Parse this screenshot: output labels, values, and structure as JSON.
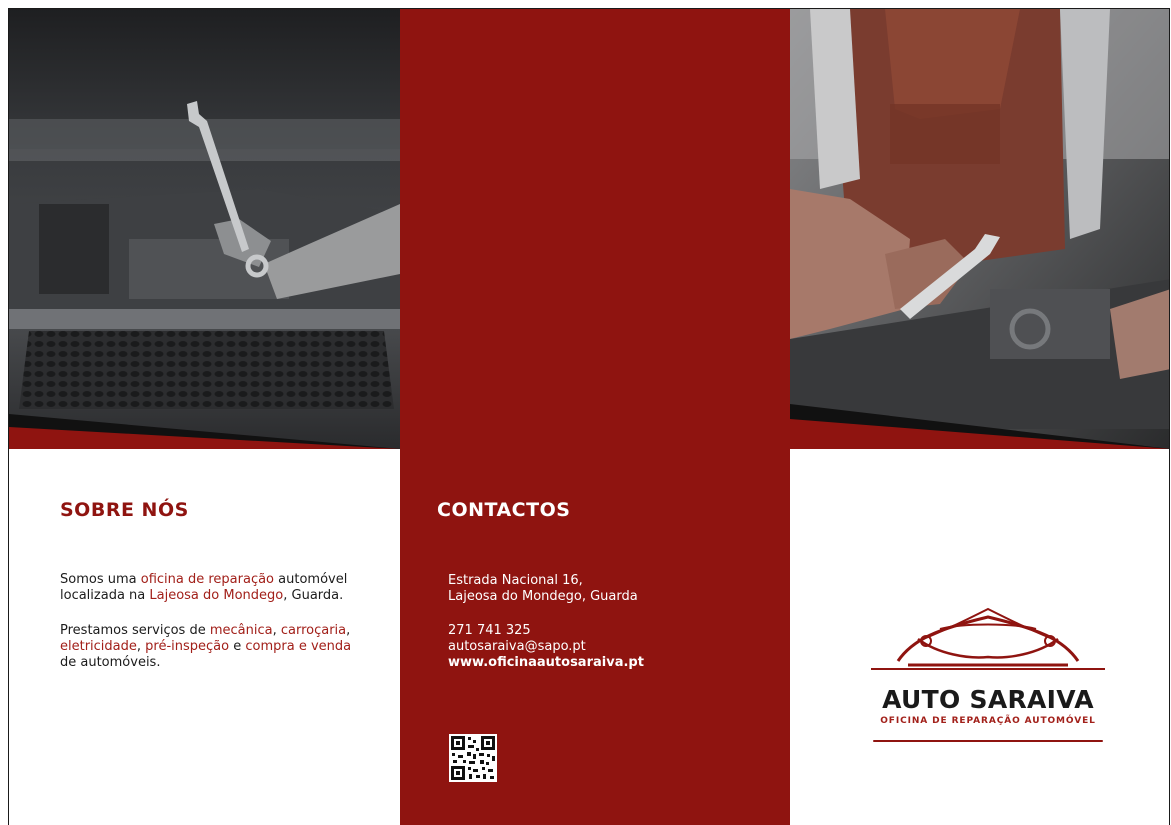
{
  "about": {
    "title": "SOBRE NÓS",
    "p1": {
      "t1": "Somos uma ",
      "h1": "oficina de reparação",
      "t2": " automóvel localizada na ",
      "h2": "Lajeosa do Mondego",
      "t3": ", Guarda."
    },
    "p2": {
      "t1": "Prestamos serviços de ",
      "h1": "mecânica",
      "t2": ", ",
      "h2": "carroçaria",
      "t3": ", ",
      "h3": "eletricidade",
      "t4": ", ",
      "h4": "pré-inspeção",
      "t5": " e ",
      "h5": "compra e venda",
      "t6": " de automóveis."
    }
  },
  "contacts": {
    "title": "CONTACTOS",
    "address_line1": "Estrada Nacional 16,",
    "address_line2": "Lajeosa do Mondego, Guarda",
    "phone": "271 741 325",
    "email": "autosaraiva@sapo.pt",
    "website": "www.oficinaautosaraiva.pt"
  },
  "logo": {
    "brand": "AUTO SARAIVA",
    "tagline": "OFICINA DE REPARAÇÃO AUTOMÓVEL"
  },
  "colors": {
    "accent": "#8f1410",
    "highlight": "#a2201a",
    "text": "#1c1c1c"
  }
}
